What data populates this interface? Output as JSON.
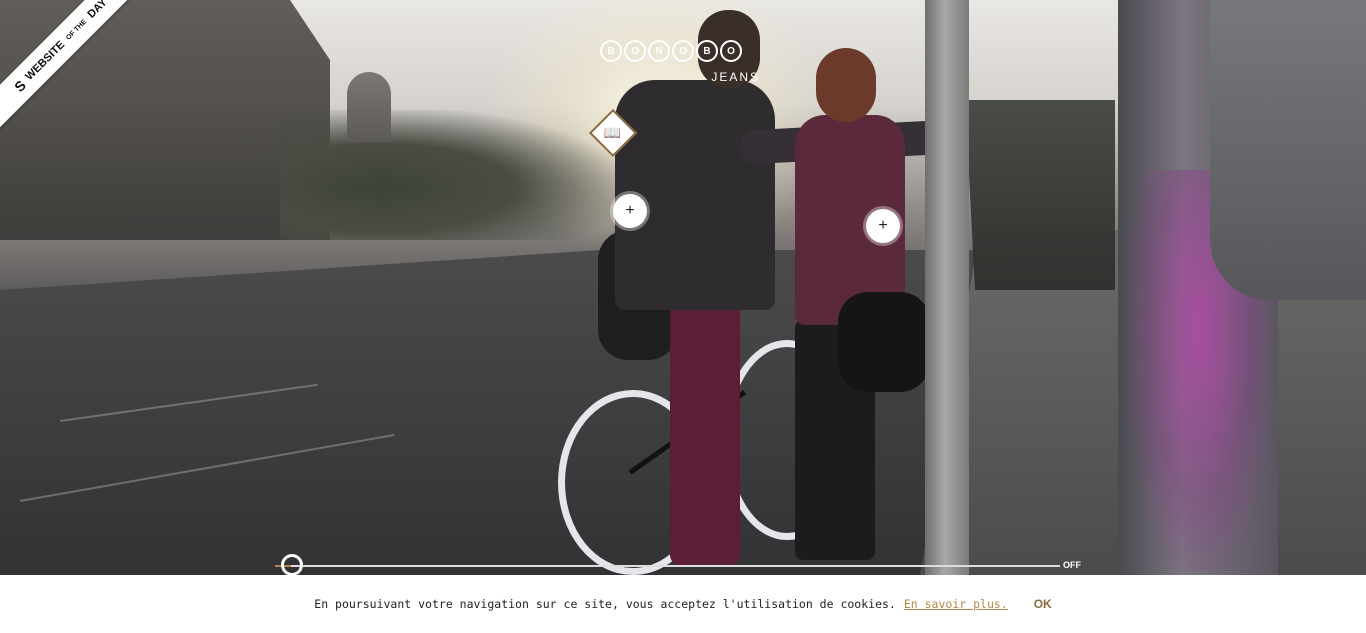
{
  "ribbon": {
    "label": "WEBSITE",
    "of": "OF THE",
    "day": "DAY",
    "logo": "S"
  },
  "logo": {
    "letters": [
      "B",
      "O",
      "N",
      "O",
      "B",
      "O"
    ],
    "sub": "JEANS"
  },
  "lookbook_button": {
    "icon": "book-icon",
    "glyph": "📖"
  },
  "hotspots": [
    {
      "glyph": "+"
    },
    {
      "glyph": "+"
    }
  ],
  "slider": {
    "off_label": "OFF",
    "progress": 0.02
  },
  "cookie": {
    "text": "En poursuivant votre navigation sur ce site, vous acceptez l'utilisation de cookies.",
    "link": "En savoir plus.",
    "ok": "OK"
  },
  "colors": {
    "accent": "#b8874a",
    "accent_dark": "#8a6a3c"
  }
}
